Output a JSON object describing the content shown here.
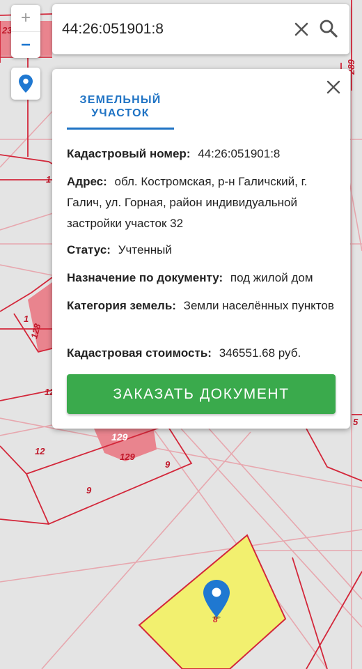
{
  "search": {
    "value": "44:26:051901:8",
    "icons": {
      "clear": "close-icon",
      "search": "search-icon"
    }
  },
  "zoom": {
    "in_label": "+",
    "out_label": "−"
  },
  "locate": {
    "icon": "location-pin-icon"
  },
  "popup": {
    "tab_label": "Земельный участок",
    "fields": [
      {
        "label": "Кадастровый номер:",
        "value": "44:26:051901:8"
      },
      {
        "label": "Адрес:",
        "value": "обл. Костромская, р-н Галичский, г. Галич, ул. Горная, район индивидуальной застройки участок 32"
      },
      {
        "label": "Статус:",
        "value": "Учтенный"
      },
      {
        "label": "Назначение по документу:",
        "value": "под жилой дом"
      },
      {
        "label": "Категория земель:",
        "value": "Земли населённых пунктов"
      },
      {
        "label": "Кадастровая стоимость:",
        "value": "346551.68 руб."
      }
    ],
    "order_button": "ЗАКАЗАТЬ ДОКУМЕНТ"
  },
  "map": {
    "labels": [
      "23",
      "289",
      "1",
      "1",
      "128",
      "12",
      "12",
      "129",
      "129",
      "9",
      "9",
      "8",
      "5"
    ],
    "colors": {
      "parcel_line": "#d3273a",
      "faint_line": "#e7a7ae",
      "building": "#e9848e",
      "highlight_fill": "#f2f06f",
      "accent_blue": "#1f73c4",
      "button_green": "#3aaa4c"
    }
  }
}
